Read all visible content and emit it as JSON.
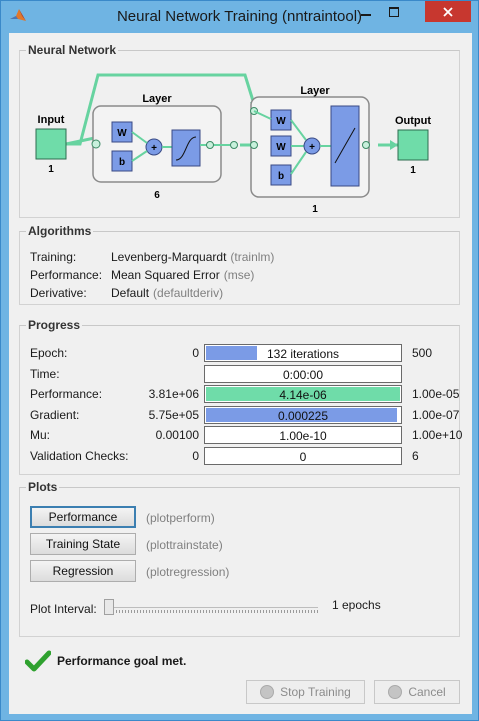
{
  "window": {
    "title": "Neural Network Training (nntraintool)"
  },
  "network": {
    "section_title": "Neural Network",
    "input_label": "Input",
    "input_size": "1",
    "hidden_layer_label": "Layer",
    "hidden_size": "6",
    "output_layer_label": "Layer",
    "output_layer_size": "1",
    "output_label": "Output",
    "output_size": "1",
    "weight_label": "W",
    "bias_label": "b",
    "sum_label": "+"
  },
  "algorithms": {
    "section_title": "Algorithms",
    "rows": [
      {
        "label": "Training:",
        "value": "Levenberg-Marquardt",
        "fn": "(trainlm)"
      },
      {
        "label": "Performance:",
        "value": "Mean Squared Error",
        "fn": "(mse)"
      },
      {
        "label": "Derivative:",
        "value": "Default",
        "fn": "(defaultderiv)"
      }
    ]
  },
  "progress": {
    "section_title": "Progress",
    "rows": [
      {
        "label": "Epoch:",
        "min": "0",
        "text": "132 iterations",
        "max": "500",
        "fill": 0.264,
        "color": "#7b9be6"
      },
      {
        "label": "Time:",
        "min": "",
        "text": "0:00:00",
        "max": "",
        "fill": 0,
        "color": "#7b9be6"
      },
      {
        "label": "Performance:",
        "min": "3.81e+06",
        "text": "4.14e-06",
        "max": "1.00e-05",
        "fill": 1.0,
        "color": "#6fdca9"
      },
      {
        "label": "Gradient:",
        "min": "5.75e+05",
        "text": "0.000225",
        "max": "1.00e-07",
        "fill": 0.985,
        "color": "#7b9be6"
      },
      {
        "label": "Mu:",
        "min": "0.00100",
        "text": "1.00e-10",
        "max": "1.00e+10",
        "fill": 0,
        "color": "#7b9be6"
      },
      {
        "label": "Validation Checks:",
        "min": "0",
        "text": "0",
        "max": "6",
        "fill": 0,
        "color": "#7b9be6"
      }
    ]
  },
  "plots": {
    "section_title": "Plots",
    "buttons": [
      {
        "label": "Performance",
        "fn": "(plotperform)"
      },
      {
        "label": "Training State",
        "fn": "(plottrainstate)"
      },
      {
        "label": "Regression",
        "fn": "(plotregression)"
      }
    ],
    "interval_label": "Plot Interval:",
    "interval_value": "1 epochs",
    "interval_level": 0
  },
  "status": {
    "text": "Performance goal met."
  },
  "footer": {
    "stop_label": "Stop Training",
    "cancel_label": "Cancel"
  }
}
